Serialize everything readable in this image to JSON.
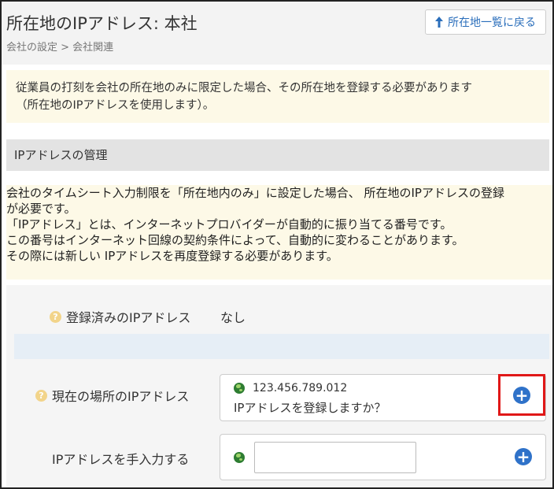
{
  "header": {
    "title": "所在地のIPアドレス: 本社",
    "breadcrumb": "会社の設定 > 会社関連",
    "back_button_label": "所在地一覧に戻る",
    "back_icon": "arrow-up-icon"
  },
  "notice": {
    "line1": "従業員の打刻を会社の所在地のみに限定した場合、その所在地を登録する必要があります",
    "line2": "（所在地のIPアドレスを使用します）。"
  },
  "section": {
    "title": "IPアドレスの管理"
  },
  "info": {
    "lines": [
      "会社のタイムシート入力制限を「所在地内のみ」に設定した場合、 所在地のIPアドレスの登録",
      "が必要です。",
      "「IPアドレス」とは、インターネットプロバイダーが自動的に振り当てる番号です。",
      "この番号はインターネット回線の契約条件によって、自動的に変わることがあります。",
      "その際には新しい IPアドレスを再度登録する必要があります。"
    ]
  },
  "form": {
    "registered_label": "登録済みのIPアドレス",
    "registered_value": "なし",
    "current_label": "現在の場所のIPアドレス",
    "current_ip": "123.456.789.012",
    "current_question": "IPアドレスを登録しますか？",
    "manual_label": "IPアドレスを手入力する",
    "manual_value": "",
    "help_glyph": "?",
    "add_glyph": "+"
  },
  "colors": {
    "accent": "#2f72c9",
    "highlight": "#e01818",
    "notice_bg": "#fdf9e7"
  }
}
